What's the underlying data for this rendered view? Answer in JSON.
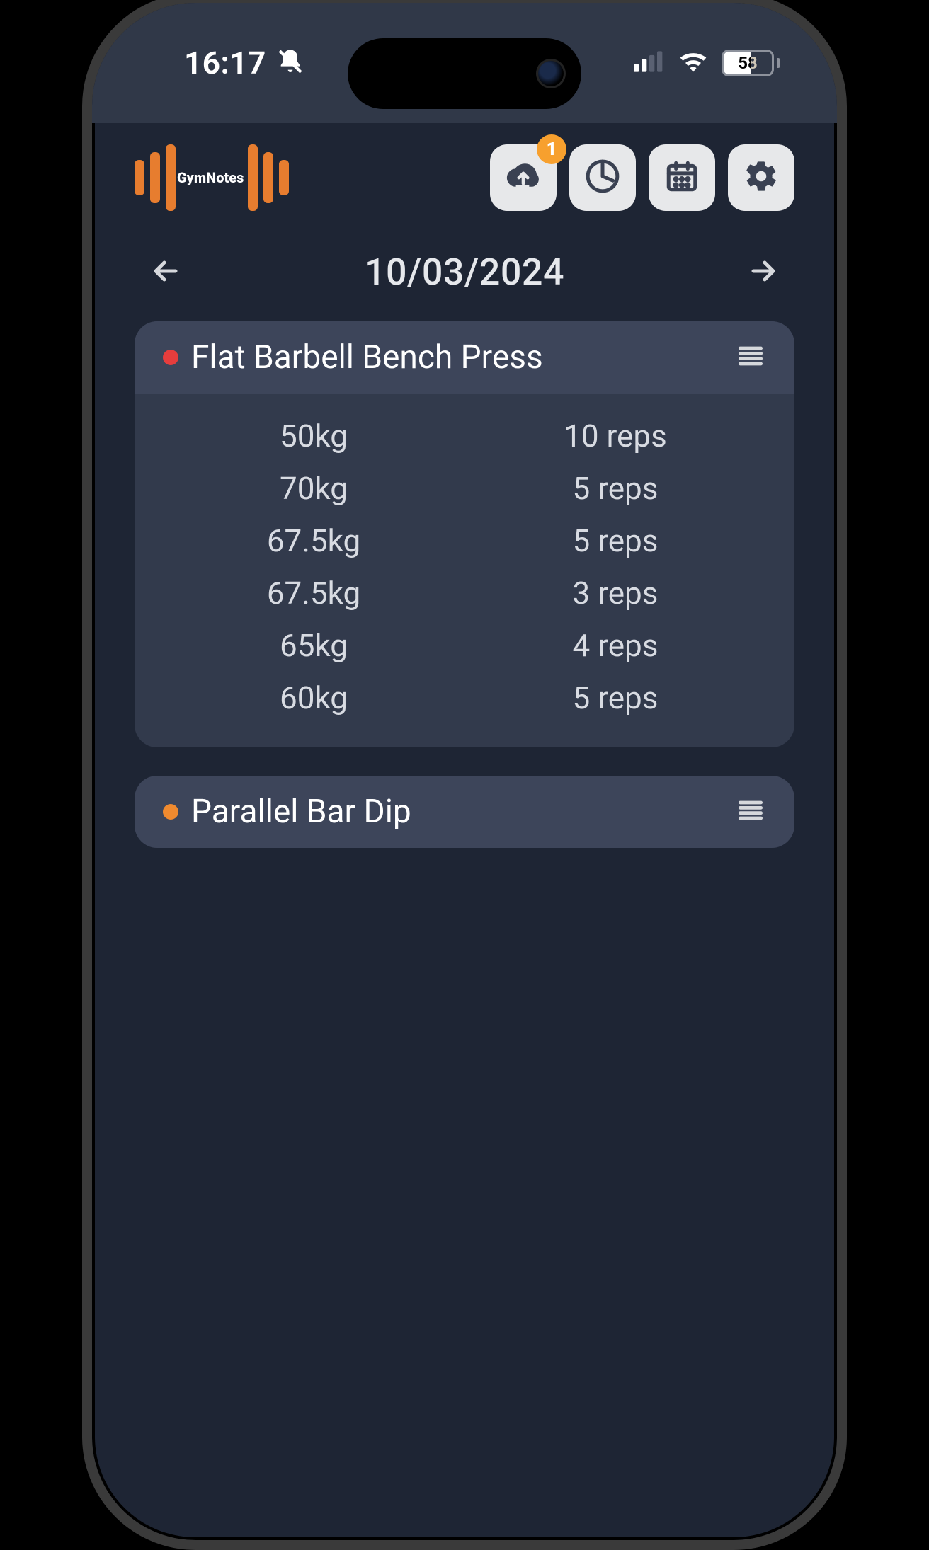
{
  "status": {
    "time": "16:17",
    "battery_pct": "58"
  },
  "app_name": "GymNotes",
  "header": {
    "upload_badge": "1"
  },
  "date": "10/03/2024",
  "exercises": [
    {
      "name": "Flat Barbell Bench Press",
      "color": "red",
      "sets": [
        {
          "weight": "50kg",
          "reps": "10 reps"
        },
        {
          "weight": "70kg",
          "reps": "5 reps"
        },
        {
          "weight": "67.5kg",
          "reps": "5 reps"
        },
        {
          "weight": "67.5kg",
          "reps": "3 reps"
        },
        {
          "weight": "65kg",
          "reps": "4 reps"
        },
        {
          "weight": "60kg",
          "reps": "5 reps"
        }
      ]
    },
    {
      "name": "Parallel Bar Dip",
      "color": "orange",
      "sets": []
    }
  ]
}
